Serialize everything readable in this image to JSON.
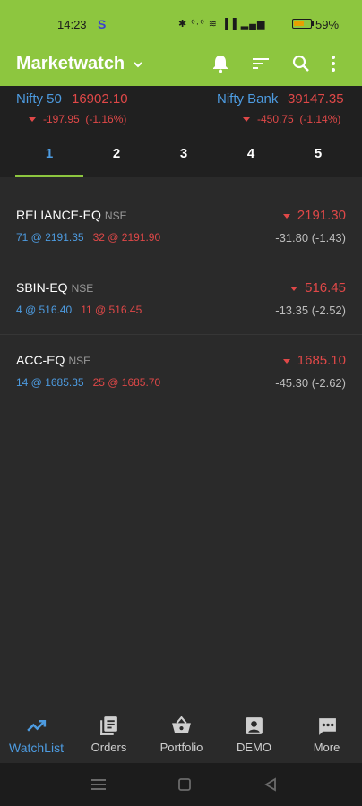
{
  "status": {
    "time": "14:23",
    "app_letter": "S",
    "sys_icons": "✱ ⁰·⁰ ≋ ▐▐ ▂▄▆",
    "battery": "59%"
  },
  "appbar": {
    "title": "Marketwatch"
  },
  "indices": [
    {
      "name": "Nifty 50",
      "value": "16902.10",
      "change": "-197.95",
      "pct": "(-1.16%)"
    },
    {
      "name": "Nifty Bank",
      "value": "39147.35",
      "change": "-450.75",
      "pct": "(-1.14%)"
    }
  ],
  "tabs": [
    "1",
    "2",
    "3",
    "4",
    "5"
  ],
  "watchlist": [
    {
      "symbol": "RELIANCE-EQ",
      "exchange": "NSE",
      "bid": "71 @ 2191.35",
      "ask": "32 @ 2191.90",
      "ltp": "2191.30",
      "change": "-31.80 (-1.43)"
    },
    {
      "symbol": "SBIN-EQ",
      "exchange": "NSE",
      "bid": "4 @ 516.40",
      "ask": "11 @ 516.45",
      "ltp": "516.45",
      "change": "-13.35 (-2.52)"
    },
    {
      "symbol": "ACC-EQ",
      "exchange": "NSE",
      "bid": "14 @ 1685.35",
      "ask": "25 @ 1685.70",
      "ltp": "1685.10",
      "change": "-45.30 (-2.62)"
    }
  ],
  "nav": [
    {
      "label": "WatchList",
      "icon": "trending-up-icon"
    },
    {
      "label": "Orders",
      "icon": "orders-icon"
    },
    {
      "label": "Portfolio",
      "icon": "basket-icon"
    },
    {
      "label": "DEMO",
      "icon": "account-box-icon"
    },
    {
      "label": "More",
      "icon": "more-chat-icon"
    }
  ],
  "colors": {
    "accent": "#8dc63f",
    "up_blue": "#4d9be0",
    "down_red": "#e04848"
  }
}
